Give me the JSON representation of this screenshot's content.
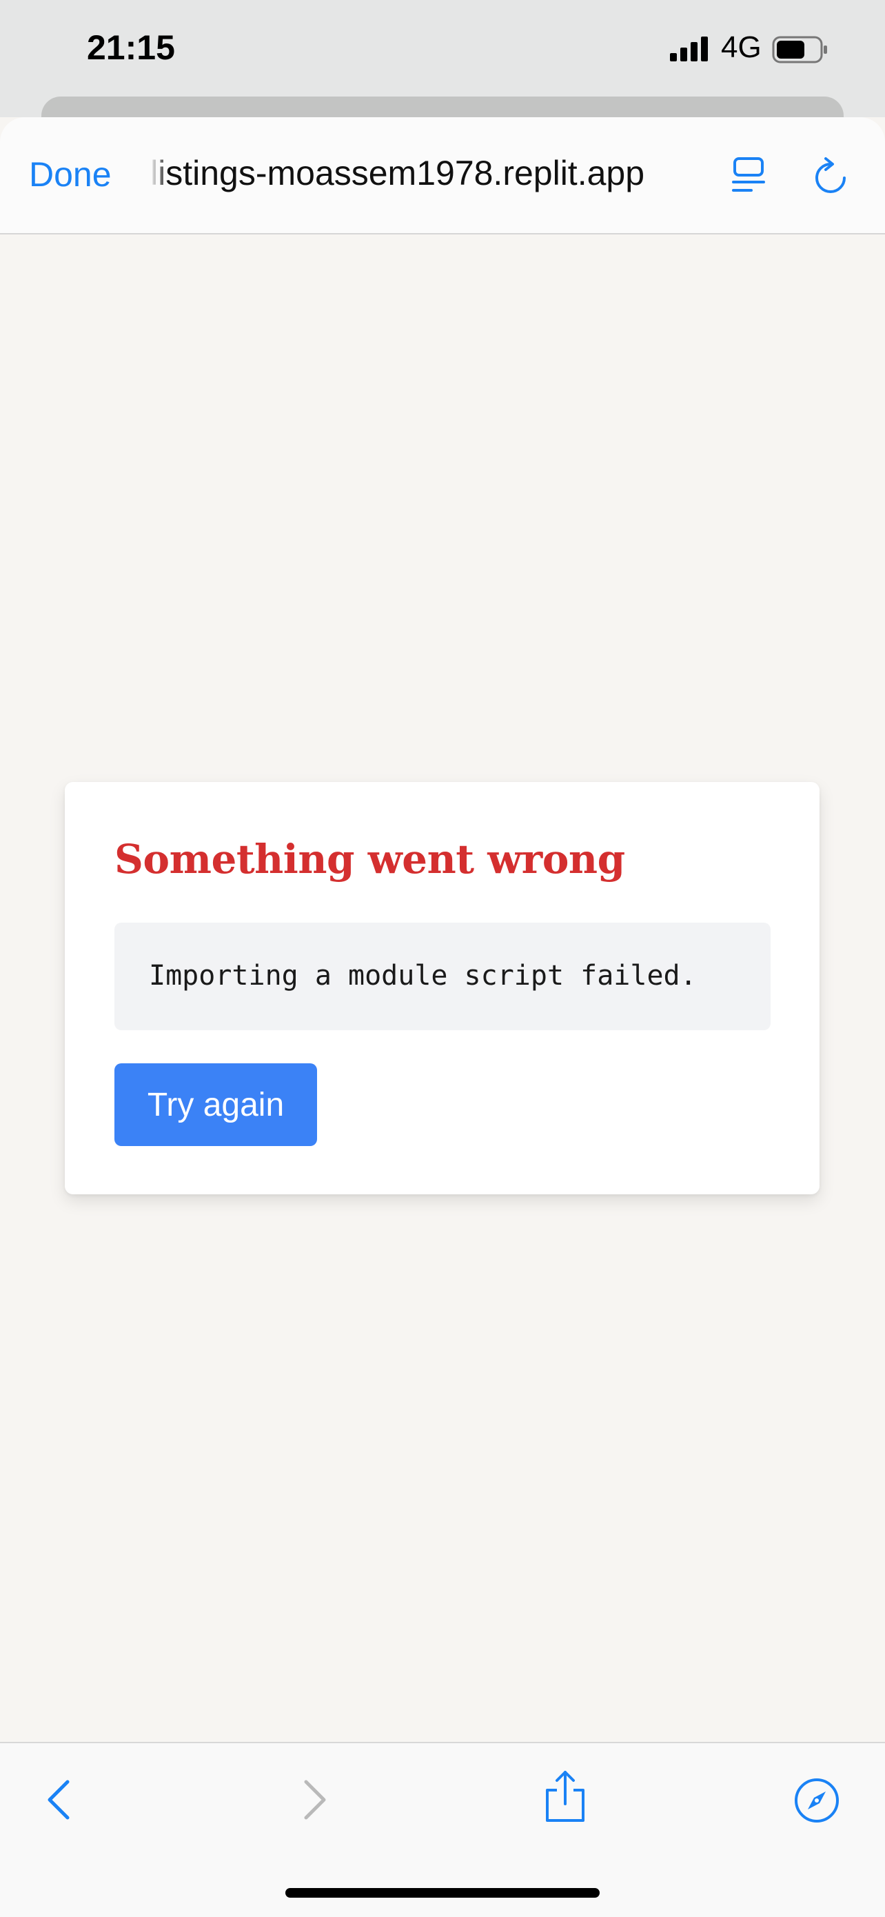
{
  "status_bar": {
    "time": "21:15",
    "network": "4G",
    "icons": [
      "signal-icon",
      "battery-icon"
    ]
  },
  "browser": {
    "done_label": "Done",
    "url": "listings-moassem1978.replit.app",
    "icons": [
      "reader-icon",
      "reload-icon"
    ],
    "accent_color": "#1a82f5"
  },
  "error_card": {
    "title": "Something went wrong",
    "message": "Importing a module script failed.",
    "button_label": "Try again",
    "title_color": "#d42f2f",
    "button_color": "#3b82f6"
  },
  "toolbar": {
    "icons": [
      "back-icon",
      "forward-icon",
      "share-icon",
      "compass-icon"
    ]
  }
}
